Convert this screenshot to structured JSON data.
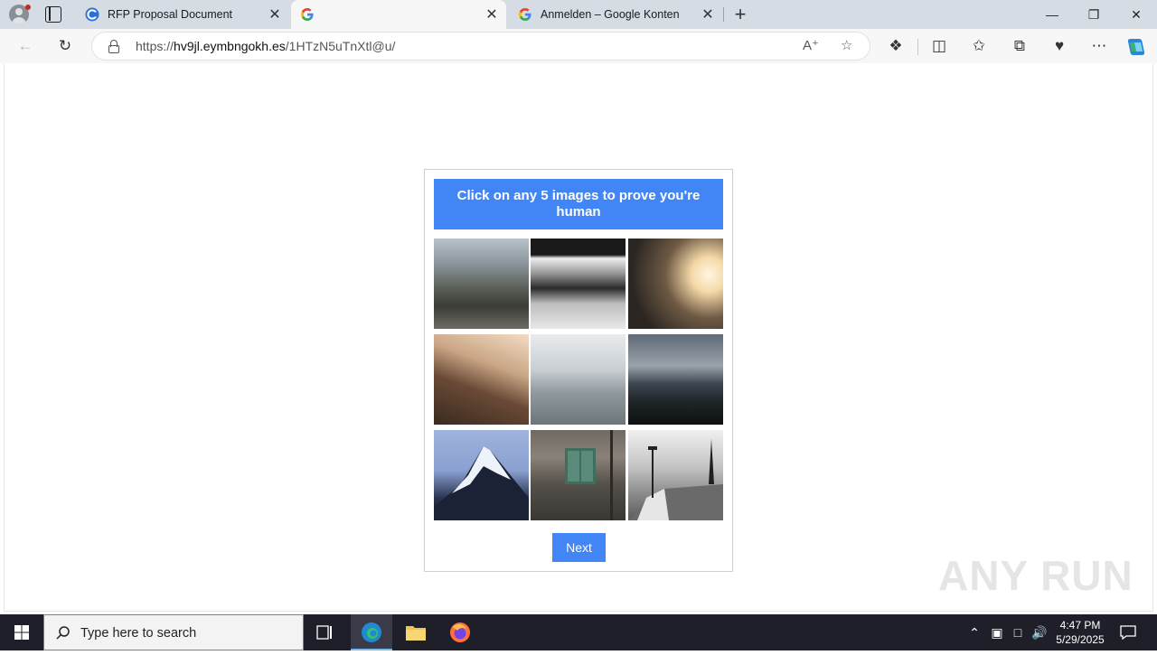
{
  "browser": {
    "tabs": [
      {
        "title": "RFP Proposal Document",
        "favicon": "copilot-c-icon"
      },
      {
        "title": "",
        "favicon": "google-g-icon",
        "active": true
      },
      {
        "title": "Anmelden – Google Konten",
        "favicon": "google-g-icon"
      }
    ],
    "new_tab_label": "+",
    "close_glyph": "✕",
    "url_prefix": "https://",
    "url_host": "hv9jl.eymbngokh.es",
    "url_path": "/1HTzN5uTnXtl@u/"
  },
  "captcha": {
    "instruction": "Click on any 5 images to prove you're human",
    "images": [
      "street-scene",
      "motion-blur-train",
      "person-sunset",
      "coastal-cliff",
      "foggy-bridge",
      "ocean-waves",
      "snowy-mountain-peak",
      "old-building-window",
      "pier-lamp"
    ],
    "next_label": "Next",
    "accent_color": "#4285f4"
  },
  "watermark": "ANY RUN",
  "taskbar": {
    "search_placeholder": "Type here to search",
    "time": "4:47 PM",
    "date": "5/29/2025"
  }
}
